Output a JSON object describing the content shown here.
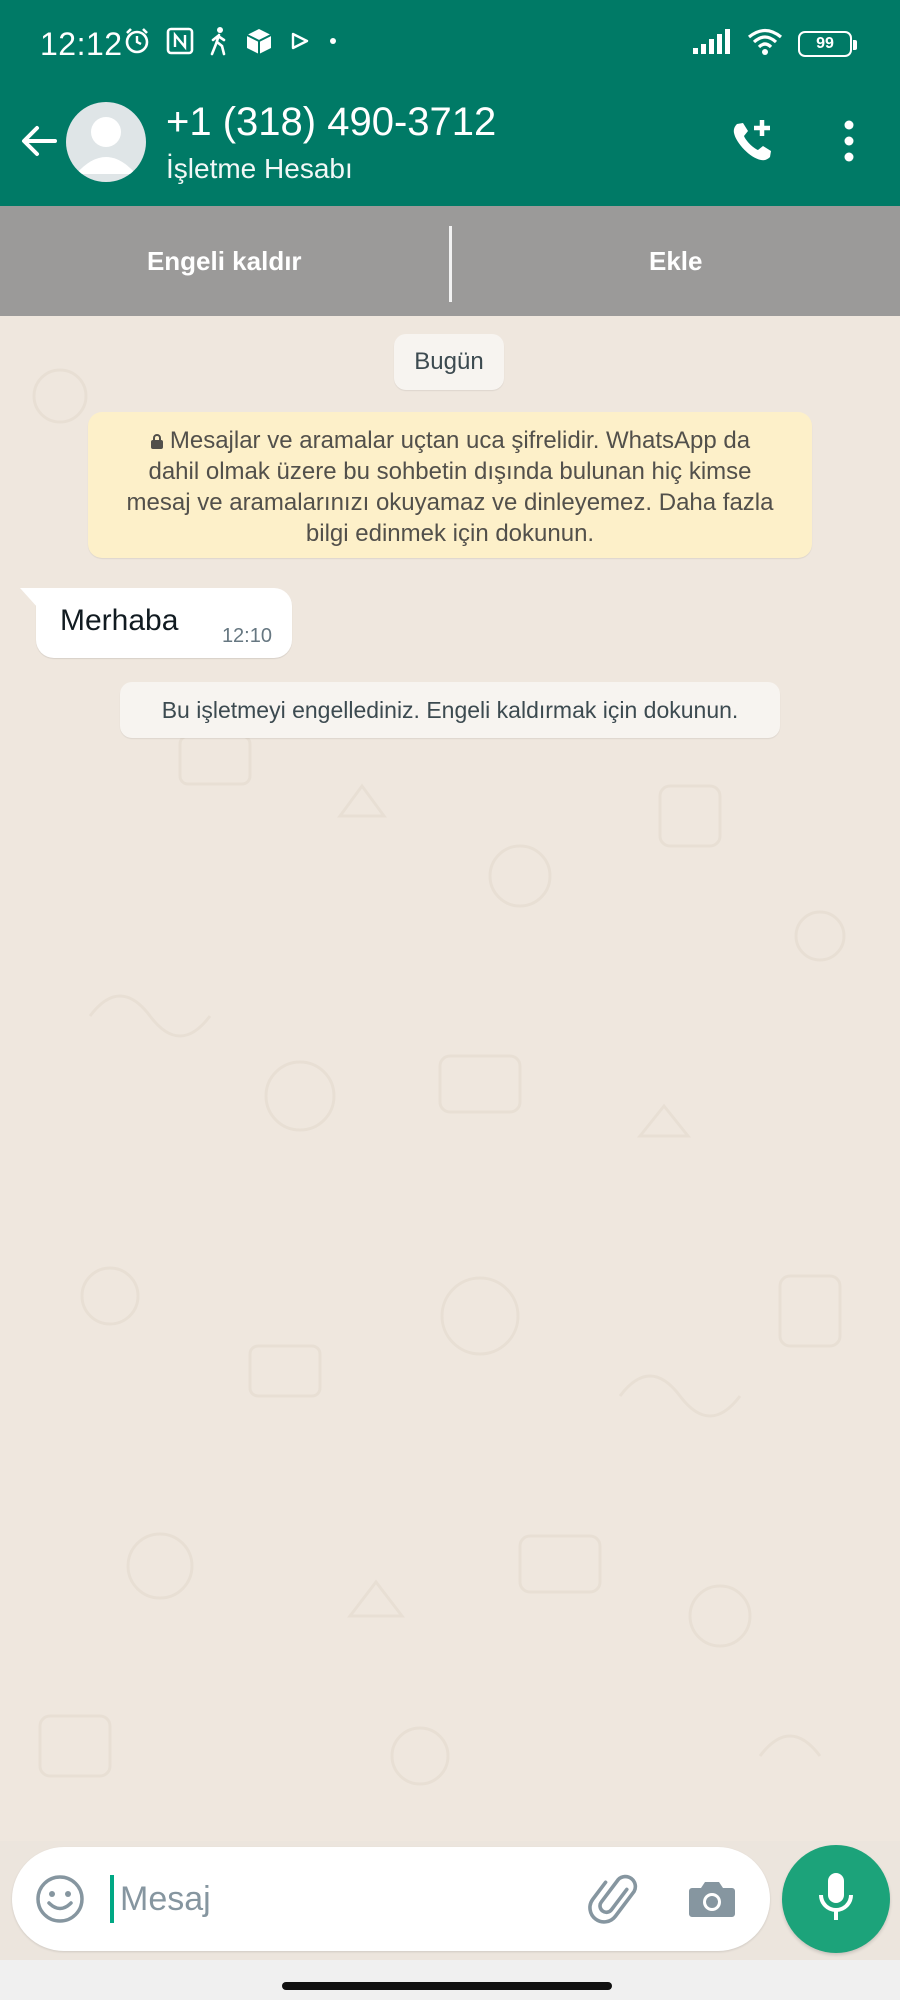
{
  "status_bar": {
    "time": "12:12",
    "battery": "99",
    "icons": [
      "alarm-icon",
      "nfc-icon",
      "walking-icon",
      "package-icon",
      "play-store-icon",
      "dot-icon",
      "signal-icon",
      "wifi-icon",
      "battery-icon"
    ]
  },
  "header": {
    "title": "+1 (318) 490-3712",
    "subtitle": "İşletme Hesabı",
    "icons": [
      "back-arrow-icon",
      "avatar",
      "add-call-icon",
      "more-vert-icon"
    ]
  },
  "actions": {
    "unblock": "Engeli kaldır",
    "add": "Ekle"
  },
  "chat": {
    "date_chip": "Bugün",
    "encryption_notice": {
      "lines": [
        "Mesajlar ve aramalar uçtan uca şifrelidir. WhatsApp da",
        "dahil olmak üzere bu sohbetin dışında bulunan hiç kimse",
        "mesaj ve aramalarınızı okuyamaz ve dinleyemez. Daha fazla",
        "bilgi edinmek için dokunun."
      ]
    },
    "messages": [
      {
        "text": "Merhaba",
        "time": "12:10",
        "direction": "incoming"
      }
    ],
    "system_notice": "Bu işletmeyi engellediniz. Engeli kaldırmak için dokunun."
  },
  "composer": {
    "placeholder": "Mesaj",
    "icons": [
      "emoji-icon",
      "attach-icon",
      "camera-icon",
      "mic-icon"
    ]
  },
  "colors": {
    "header": "#007a66",
    "action_bar": "#9b9a99",
    "chat_bg": "#efe7de",
    "notice_bg": "#fdf0c9",
    "mic_button": "#1ca37a"
  }
}
